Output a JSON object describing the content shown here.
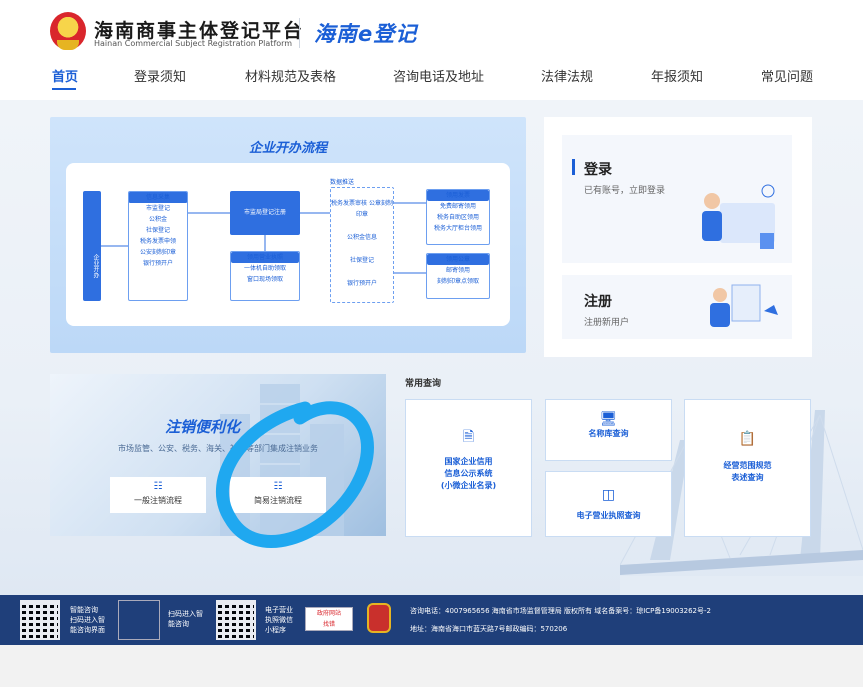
{
  "header": {
    "logo_cn": "海南商事主体登记平台",
    "logo_en": "Hainan Commercial Subject Registration Platform",
    "logo_e": "海南e登记"
  },
  "nav": [
    {
      "label": "首页"
    },
    {
      "label": "登录须知"
    },
    {
      "label": "材料规范及表格"
    },
    {
      "label": "咨询电话及地址"
    },
    {
      "label": "法律法规"
    },
    {
      "label": "年报须知"
    },
    {
      "label": "常见问题"
    }
  ],
  "flow": {
    "title": "企业开办流程",
    "start": "企业开办",
    "collect": {
      "head": "信息采集",
      "items": [
        "市监登记",
        "公积金",
        "社保登记",
        "税务发票申领",
        "公安刻制印章",
        "银行预开户"
      ]
    },
    "register": "市监局登记注册",
    "license": {
      "head": "领用营业执照",
      "items": [
        "一体机自助领取",
        "窗口现场领取"
      ]
    },
    "push_label": "数据推送",
    "push": [
      "税务发票审核 公章刻制印章",
      "公积金信息",
      "社保登记",
      "银行预开户"
    ],
    "invoice": {
      "head": "领用发票",
      "items": [
        "免费邮寄领用",
        "税务自助区领用",
        "税务大厅柜台领用"
      ]
    },
    "seal": {
      "head": "领用公章",
      "items": [
        "邮寄领用",
        "刻制印章点领取"
      ]
    }
  },
  "login": {
    "title": "登录",
    "sub": "已有账号，立即登录"
  },
  "register": {
    "title": "注册",
    "sub": "注册新用户"
  },
  "cancel": {
    "title": "注销便利化",
    "sub": "市场监管、公安、税务、海关、社保等部门集成注销业务",
    "btn1": "一般注销流程",
    "btn2": "简易注销流程"
  },
  "common": {
    "label": "常用查询",
    "gsxt": [
      "国家企业信用",
      "信息公示系统",
      "(小微企业名录)"
    ],
    "name": "名称库查询",
    "scope": [
      "经营范围规范",
      "表述查询"
    ],
    "elicense": "电子营业执照查询"
  },
  "footer": {
    "qr1": [
      "智能咨询",
      "扫码进入智",
      "能咨询界面"
    ],
    "qr2": [
      "扫码进入智",
      "能咨询"
    ],
    "qr3": [
      "电子营业",
      "执照微信",
      "小程序"
    ],
    "gov_badge": [
      "政府网站",
      "找错"
    ],
    "line1": "咨询电话：4007965656 海南省市场监督管理局 版权所有 域名备案号：琼ICP备19003262号-2",
    "line2": "地址：海南省海口市蓝天路7号邮政编码：570206"
  },
  "colors": {
    "primary": "#1b5fd6",
    "footer": "#1f3f7a",
    "scribble": "#1fa8f0"
  }
}
